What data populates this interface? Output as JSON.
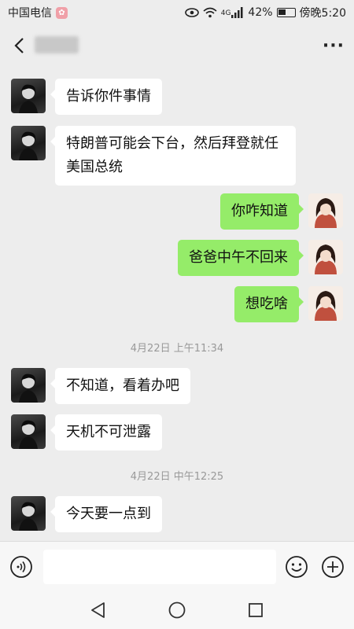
{
  "status_bar": {
    "carrier": "中国电信",
    "network_badge": "4G",
    "battery": "42%",
    "time": "傍晚5:20"
  },
  "nav": {
    "more_label": "···"
  },
  "messages": [
    {
      "side": "left",
      "text": "告诉你件事情"
    },
    {
      "side": "left",
      "text": "特朗普可能会下台，然后拜登就任美国总统"
    },
    {
      "side": "right",
      "text": "你咋知道"
    },
    {
      "side": "right",
      "text": "爸爸中午不回来"
    },
    {
      "side": "right",
      "text": "想吃啥"
    },
    {
      "side": "left",
      "text": "不知道，看着办吧"
    },
    {
      "side": "left",
      "text": "天机不可泄露"
    },
    {
      "side": "left",
      "text": "今天要一点到"
    }
  ],
  "timestamps": [
    "4月22日 上午11:34",
    "4月22日 中午12:25"
  ],
  "input": {
    "placeholder": "",
    "value": ""
  },
  "colors": {
    "background": "#ededed",
    "sent_bubble": "#95ec69",
    "received_bubble": "#ffffff"
  },
  "icons": [
    "back-icon",
    "more-icon",
    "voice-icon",
    "emoji-icon",
    "plus-icon",
    "nav-back-icon",
    "nav-home-icon",
    "nav-recents-icon"
  ]
}
